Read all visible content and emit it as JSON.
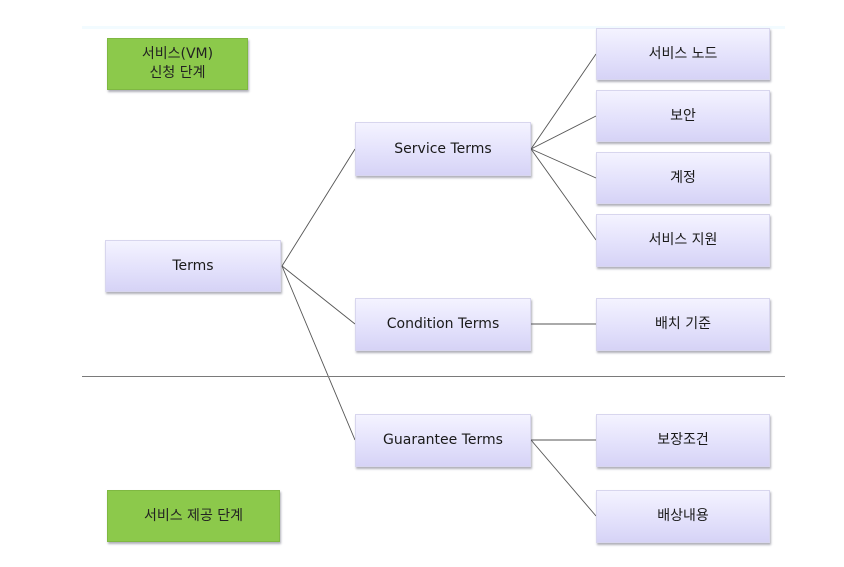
{
  "phases": {
    "request": "서비스(VM)\n신청 단계",
    "request_line1": "서비스(VM)",
    "request_line2": "신청 단계",
    "provide": "서비스 제공 단계"
  },
  "root": {
    "label": "Terms"
  },
  "branches": [
    {
      "label": "Service Terms",
      "children": [
        "서비스 노드",
        "보안",
        "계정",
        "서비스 지원"
      ]
    },
    {
      "label": "Condition Terms",
      "children": [
        "배치 기준"
      ]
    },
    {
      "label": "Guarantee Terms",
      "children": [
        "보장조건",
        "배상내용"
      ]
    }
  ],
  "colors": {
    "phase_box": "#8cc94b",
    "term_box": "#e2e0fb",
    "connector": "#555555",
    "separator": "#7a7a7a"
  }
}
